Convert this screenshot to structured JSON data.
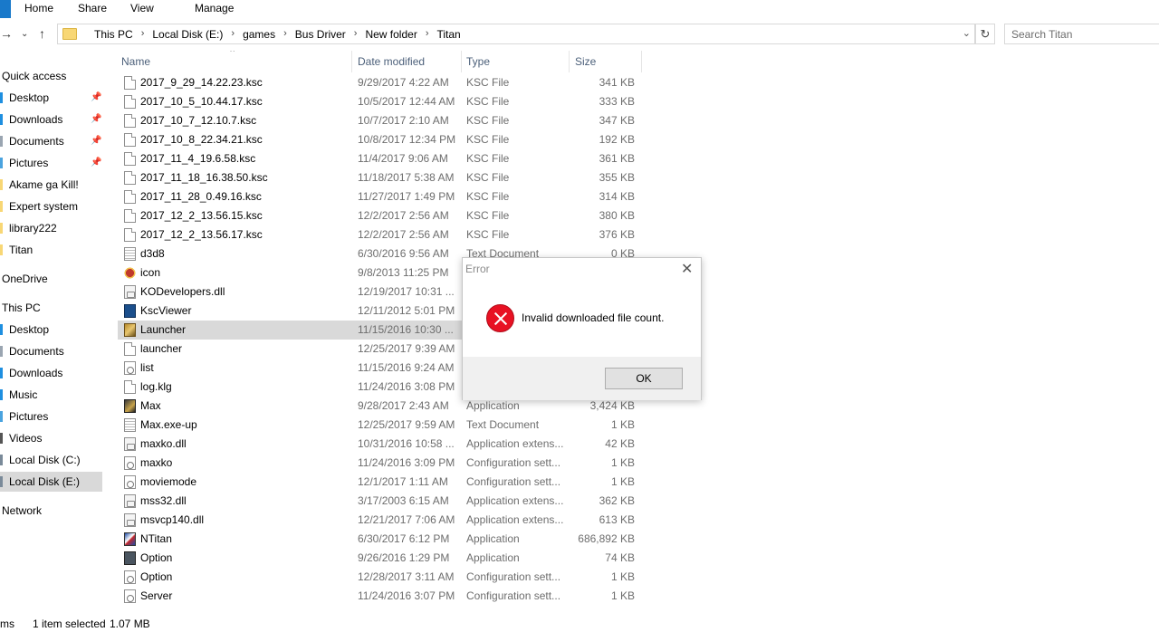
{
  "ribbon": {
    "tabs": [
      "Home",
      "Share",
      "View",
      "Manage"
    ]
  },
  "address": {
    "crumbs": [
      "This PC",
      "Local Disk (E:)",
      "games",
      "Bus Driver",
      "New folder",
      "Titan"
    ],
    "search_placeholder": "Search Titan"
  },
  "nav": {
    "quick_access": "Quick access",
    "quick_items": [
      "Desktop",
      "Downloads",
      "Documents",
      "Pictures",
      "Akame ga Kill!",
      "Expert system",
      "library222",
      "Titan"
    ],
    "onedrive": "OneDrive",
    "this_pc": "This PC",
    "pc_items": [
      "Desktop",
      "Documents",
      "Downloads",
      "Music",
      "Pictures",
      "Videos",
      "Local Disk (C:)",
      "Local Disk (E:)"
    ],
    "network": "Network"
  },
  "columns": {
    "name": "Name",
    "date": "Date modified",
    "type": "Type",
    "size": "Size"
  },
  "files": [
    {
      "name": "2017_9_29_14.22.23.ksc",
      "date": "9/29/2017 4:22 AM",
      "type": "KSC File",
      "size": "341 KB",
      "icon": "doc-icon"
    },
    {
      "name": "2017_10_5_10.44.17.ksc",
      "date": "10/5/2017 12:44 AM",
      "type": "KSC File",
      "size": "333 KB",
      "icon": "doc-icon"
    },
    {
      "name": "2017_10_7_12.10.7.ksc",
      "date": "10/7/2017 2:10 AM",
      "type": "KSC File",
      "size": "347 KB",
      "icon": "doc-icon"
    },
    {
      "name": "2017_10_8_22.34.21.ksc",
      "date": "10/8/2017 12:34 PM",
      "type": "KSC File",
      "size": "192 KB",
      "icon": "doc-icon"
    },
    {
      "name": "2017_11_4_19.6.58.ksc",
      "date": "11/4/2017 9:06 AM",
      "type": "KSC File",
      "size": "361 KB",
      "icon": "doc-icon"
    },
    {
      "name": "2017_11_18_16.38.50.ksc",
      "date": "11/18/2017 5:38 AM",
      "type": "KSC File",
      "size": "355 KB",
      "icon": "doc-icon"
    },
    {
      "name": "2017_11_28_0.49.16.ksc",
      "date": "11/27/2017 1:49 PM",
      "type": "KSC File",
      "size": "314 KB",
      "icon": "doc-icon"
    },
    {
      "name": "2017_12_2_13.56.15.ksc",
      "date": "12/2/2017 2:56 AM",
      "type": "KSC File",
      "size": "380 KB",
      "icon": "doc-icon"
    },
    {
      "name": "2017_12_2_13.56.17.ksc",
      "date": "12/2/2017 2:56 AM",
      "type": "KSC File",
      "size": "376 KB",
      "icon": "doc-icon"
    },
    {
      "name": "d3d8",
      "date": "6/30/2016 9:56 AM",
      "type": "Text Document",
      "size": "0 KB",
      "icon": "text-icon"
    },
    {
      "name": "icon",
      "date": "9/8/2013 11:25 PM",
      "type": "",
      "size": "",
      "icon": "icon-file-icon"
    },
    {
      "name": "KODevelopers.dll",
      "date": "12/19/2017 10:31 ...",
      "type": "",
      "size": "",
      "icon": "dll-icon"
    },
    {
      "name": "KscViewer",
      "date": "12/11/2012 5:01 PM",
      "type": "",
      "size": "",
      "icon": "ksc-viewer-icon"
    },
    {
      "name": "Launcher",
      "date": "11/15/2016 10:30 ...",
      "type": "",
      "size": "",
      "icon": "launcher-app-icon",
      "selected": true
    },
    {
      "name": "launcher",
      "date": "12/25/2017 9:39 AM",
      "type": "",
      "size": "",
      "icon": "doc-icon"
    },
    {
      "name": "list",
      "date": "11/15/2016 9:24 AM",
      "type": "",
      "size": "",
      "icon": "config-icon"
    },
    {
      "name": "log.klg",
      "date": "11/24/2016 3:08 PM",
      "type": "",
      "size": "",
      "icon": "doc-icon"
    },
    {
      "name": "Max",
      "date": "9/28/2017 2:43 AM",
      "type": "Application",
      "size": "3,424 KB",
      "icon": "max-app-icon"
    },
    {
      "name": "Max.exe-up",
      "date": "12/25/2017 9:59 AM",
      "type": "Text Document",
      "size": "1 KB",
      "icon": "text-icon"
    },
    {
      "name": "maxko.dll",
      "date": "10/31/2016 10:58 ...",
      "type": "Application extens...",
      "size": "42 KB",
      "icon": "dll-icon"
    },
    {
      "name": "maxko",
      "date": "11/24/2016 3:09 PM",
      "type": "Configuration sett...",
      "size": "1 KB",
      "icon": "config-icon"
    },
    {
      "name": "moviemode",
      "date": "12/1/2017 1:11 AM",
      "type": "Configuration sett...",
      "size": "1 KB",
      "icon": "config-icon"
    },
    {
      "name": "mss32.dll",
      "date": "3/17/2003 6:15 AM",
      "type": "Application extens...",
      "size": "362 KB",
      "icon": "dll-icon"
    },
    {
      "name": "msvcp140.dll",
      "date": "12/21/2017 7:06 AM",
      "type": "Application extens...",
      "size": "613 KB",
      "icon": "dll-icon"
    },
    {
      "name": "NTitan",
      "date": "6/30/2017 6:12 PM",
      "type": "Application",
      "size": "686,892 KB",
      "icon": "ntitan-app-icon"
    },
    {
      "name": "Option",
      "date": "9/26/2016 1:29 PM",
      "type": "Application",
      "size": "74 KB",
      "icon": "option-app-icon"
    },
    {
      "name": "Option",
      "date": "12/28/2017 3:11 AM",
      "type": "Configuration sett...",
      "size": "1 KB",
      "icon": "config-icon"
    },
    {
      "name": "Server",
      "date": "11/24/2016 3:07 PM",
      "type": "Configuration sett...",
      "size": "1 KB",
      "icon": "config-icon"
    }
  ],
  "status": {
    "count": "ms",
    "selected": "1 item selected",
    "size": "1.07 MB"
  },
  "dialog": {
    "title": "Error",
    "message": "Invalid downloaded file count.",
    "ok_label": "OK"
  }
}
